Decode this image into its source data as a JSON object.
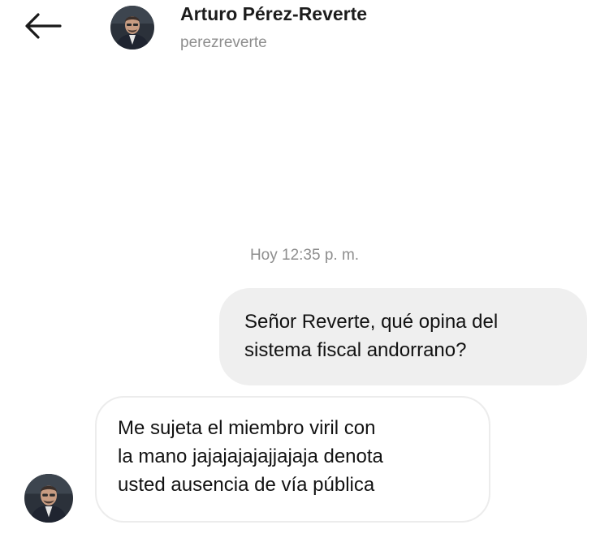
{
  "header": {
    "back_icon": "arrow-left-icon",
    "avatar_icon": "profile-photo",
    "name": "Arturo Pérez-Reverte",
    "username": "perezreverte"
  },
  "conversation": {
    "timestamp": "Hoy 12:35 p. m.",
    "messages": [
      {
        "direction": "sent",
        "lines": [
          "Señor Reverte, qué opina del",
          "sistema fiscal andorrano?"
        ]
      },
      {
        "direction": "received",
        "avatar_icon": "profile-photo",
        "lines": [
          "Me sujeta el miembro viril con",
          "la mano jajajajajajjajaja denota",
          "usted ausencia de vía pública"
        ]
      }
    ]
  },
  "colors": {
    "sent_bubble": "#efefef",
    "received_border": "#ececec",
    "secondary_text": "#8e8e8e",
    "primary_text": "#121212"
  }
}
